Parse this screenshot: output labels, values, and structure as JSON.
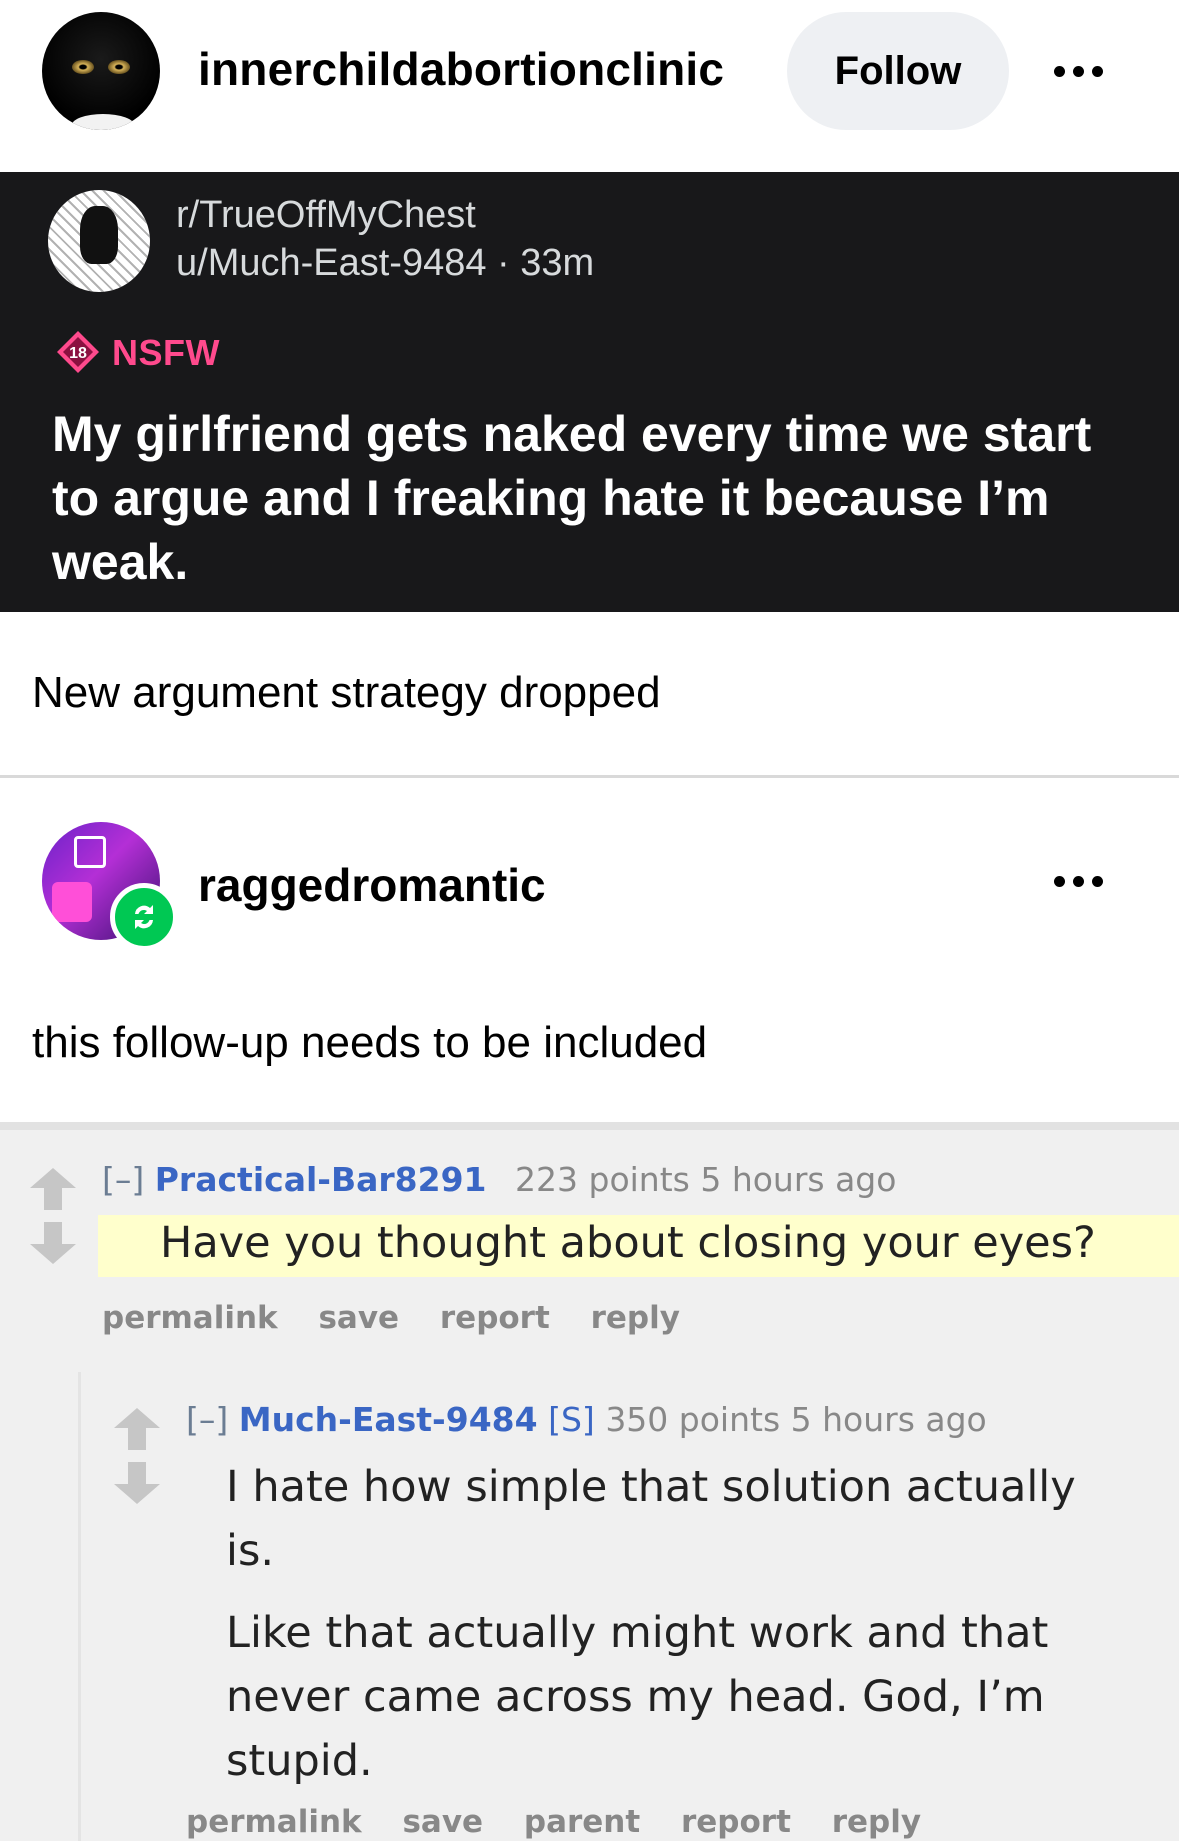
{
  "post": {
    "username": "innerchildabortionclinic",
    "follow_label": "Follow",
    "caption": "New argument strategy dropped"
  },
  "reddit_post": {
    "subreddit": "r/TrueOffMyChest",
    "user_line": "u/Much-East-9484 · 33m",
    "nsfw_number": "18",
    "nsfw_label": "NSFW",
    "title": "My girlfriend gets naked every time we start to argue and I freaking hate it because I’m weak."
  },
  "reblog": {
    "username": "raggedromantic",
    "caption": "this follow-up needs to be included"
  },
  "comments": [
    {
      "collapse": "[–]",
      "author": "Practical-Bar8291",
      "submitter_tag": "",
      "meta": "223 points 5 hours ago",
      "body": [
        "Have you thought about closing your eyes?"
      ],
      "links": [
        "permalink",
        "save",
        "report",
        "reply"
      ]
    },
    {
      "collapse": "[–]",
      "author": "Much-East-9484",
      "submitter_tag": "[S]",
      "meta": "350 points 5 hours ago",
      "body": [
        "I hate how simple that solution actually is.",
        "Like that actually might work and that never came across my head. God, I’m stupid."
      ],
      "links": [
        "permalink",
        "save",
        "parent",
        "report",
        "reply"
      ]
    }
  ],
  "colors": {
    "dark_bg": "#18181a",
    "nsfw": "#ff4a8d",
    "reblog_green": "#00c853",
    "author_blue": "#3a66c4",
    "highlight": "#ffffcc"
  }
}
